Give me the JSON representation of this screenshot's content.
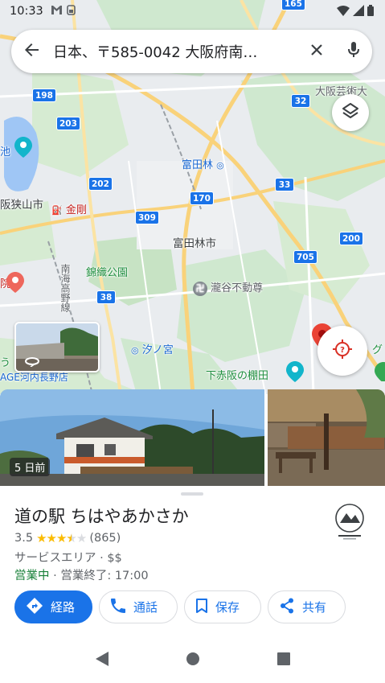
{
  "status_bar": {
    "time": "10:33",
    "icons": [
      "gmail-icon",
      "sim-icon",
      "wifi-icon",
      "signal-icon",
      "battery-icon"
    ]
  },
  "search": {
    "query": "日本、〒585-0042 大阪府南…"
  },
  "map": {
    "labels": {
      "osaka_geidai": "大阪芸術大",
      "tondabayashi_station": "富田林",
      "osakasayama": "阪狭山市",
      "kongo": "金剛",
      "tondabayashi_city": "富田林市",
      "nishiki_park": "錦織公園",
      "takiya_fudoson": "瀧谷不動尊",
      "nankai_koya": "南海高野線",
      "shionomiya": "汐ノ宮",
      "shimoakasaka": "下赤阪の棚田",
      "kawachinagano": "AGE河内長野店",
      "left_edge_1": "池",
      "left_edge_2": "院",
      "left_edge_3": "う",
      "right_edge": "グ"
    },
    "road_shields": [
      "165",
      "198",
      "203",
      "32",
      "202",
      "170",
      "33",
      "309",
      "200",
      "705",
      "38"
    ]
  },
  "photos": {
    "age_label": "5 日前"
  },
  "place": {
    "name": "道の駅 ちはやあかさか",
    "rating": "3.5",
    "rating_value": 3.5,
    "review_count": "(865)",
    "category": "サービスエリア · $$",
    "open_status": "営業中",
    "hours": " · 営業終了: 17:00",
    "actions": {
      "route": "経路",
      "call": "通話",
      "save": "保存",
      "share": "共有"
    }
  },
  "colors": {
    "accent": "#1a73e8",
    "open_green": "#188038",
    "star": "#fbbc04",
    "park_green": "#c8e6c9"
  }
}
